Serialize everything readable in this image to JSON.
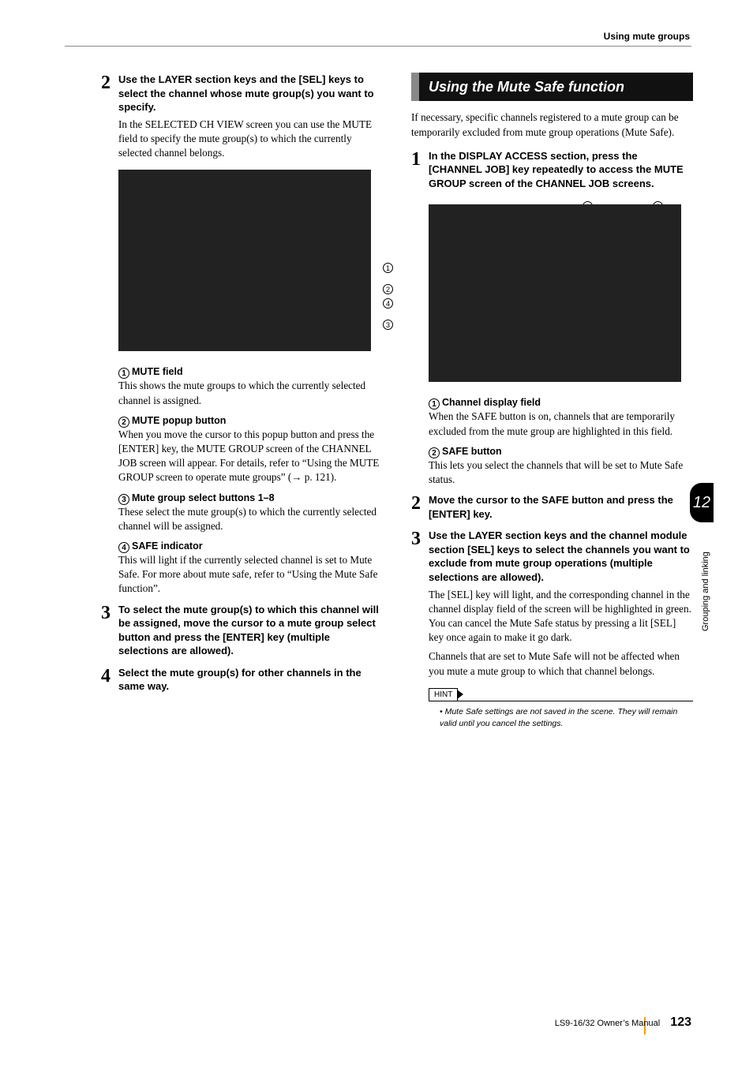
{
  "header": {
    "section": "Using mute groups"
  },
  "left": {
    "step2": {
      "head": "Use the LAYER section keys and the [SEL] keys to select the channel whose mute group(s) you want to specify.",
      "body": "In the SELECTED CH VIEW screen you can use the MUTE field to specify the mute group(s) to which the currently selected channel belongs."
    },
    "items": [
      {
        "n": "1",
        "title": "MUTE field",
        "body": "This shows the mute groups to which the currently selected channel is assigned."
      },
      {
        "n": "2",
        "title": "MUTE popup button",
        "body": "When you move the cursor to this popup button and press the [ENTER] key, the MUTE GROUP screen of the CHANNEL JOB screen will appear. For details, refer to “Using the MUTE GROUP screen to operate mute groups” (→ p. 121)."
      },
      {
        "n": "3",
        "title": "Mute group select buttons 1–8",
        "body": "These select the mute group(s) to which the currently selected channel will be assigned."
      },
      {
        "n": "4",
        "title": "SAFE indicator",
        "body": "This will light if the currently selected channel is set to Mute Safe. For more about mute safe, refer to “Using the Mute Safe function”."
      }
    ],
    "step3": {
      "head": "To select the mute group(s) to which this channel will be assigned, move the cursor to a mute group select button and press the [ENTER] key (multiple selections are allowed)."
    },
    "step4": {
      "head": "Select the mute group(s) for other channels in the same way."
    }
  },
  "right": {
    "heading": "Using the Mute Safe function",
    "intro": "If necessary, specific channels registered to a mute group can be temporarily excluded from mute group operations (Mute Safe).",
    "step1": {
      "head": "In the DISPLAY ACCESS section, press the [CHANNEL JOB] key repeatedly to access the MUTE GROUP screen of the CHANNEL JOB screens."
    },
    "items": [
      {
        "n": "1",
        "title": "Channel display field",
        "body": "When the SAFE button is on, channels that are temporarily excluded from the mute group are highlighted in this field."
      },
      {
        "n": "2",
        "title": "SAFE button",
        "body": "This lets you select the channels that will be set to Mute Safe status."
      }
    ],
    "step2": {
      "head": "Move the cursor to the SAFE button and press the [ENTER] key."
    },
    "step3": {
      "head": "Use the LAYER section keys and the channel module section [SEL] keys to select the channels you want to exclude from mute group operations (multiple selections are allowed).",
      "body1": "The [SEL] key will light, and the corresponding channel in the channel display field of the screen will be highlighted in green. You can cancel the Mute Safe status by pressing a lit [SEL] key once again to make it go dark.",
      "body2": "Channels that are set to Mute Safe will not be affected when you mute a mute group to which that channel belongs."
    },
    "hint": {
      "label": "HINT",
      "text": "Mute Safe settings are not saved in the scene. They will remain valid until you cancel the settings."
    }
  },
  "side": {
    "chapter": "12",
    "label": "Grouping and linking"
  },
  "footer": {
    "manual": "LS9-16/32  Owner’s Manual",
    "page": "123"
  },
  "callouts_left": [
    "1",
    "2",
    "4",
    "3"
  ],
  "callouts_right_top": [
    "1",
    "2"
  ]
}
